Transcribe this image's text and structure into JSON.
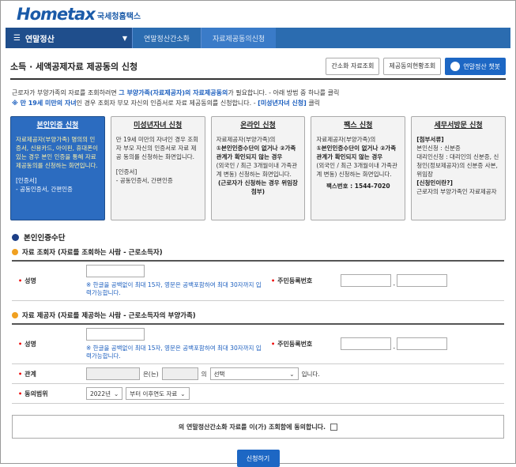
{
  "header": {
    "logo": "Hometax",
    "logo_sub": "국세청홈택스"
  },
  "nav": {
    "main": "연말정산",
    "crumbs": [
      "연말정산간소화",
      "자료제공동의신청"
    ]
  },
  "title": "소득 · 세액공제자료 제공동의 신청",
  "title_buttons": [
    "간소화 자료조회",
    "제공동의현황조회",
    "연말정산 챗봇"
  ],
  "intro": {
    "line1_a": "근로자가 부양가족의 자료를 조회하려면 ",
    "line1_hl": "그 부양가족(자료제공자)의 자료제공동의",
    "line1_b": "가 필요합니다. - 아래 방법 중 하나를 클릭",
    "line2_hl": "※ 만 19세 미만의 자녀",
    "line2_a": "인 경우 조회자 부모 자신의 인증서로 자료 제공동의를 신청합니다. - ",
    "line2_hl2": "[미성년자녀 신청]",
    "line2_b": " 클릭"
  },
  "cards": [
    {
      "title": "본인인증 신청",
      "body1": "자료제공자(부양가족) 명의의 인증서, 신용카드, 아이핀, 휴대폰이 있는 경우 본인 인증을 통해 자료제공동의를 신청하는 화면입니다.",
      "body2": "[인증서]",
      "body3": "- 공동인증서, 간편인증"
    },
    {
      "title": "미성년자녀 신청",
      "body1": "만 19세 미만의 자녀인 경우 조회자 부모 자신의 인증서로 자료 제공 동의를 신청하는 화면입니다.",
      "body2": "[인증서]",
      "body3": "- 공동인증서, 간편인증"
    },
    {
      "title": "온라인 신청",
      "body1": "자료제공자(부양가족)의",
      "body2": "①본인인증수단이 없거나 ②가족관계가 확인되지 않는 경우",
      "body3": "(외국인 / 최근 3개월이내 가족관계 변동) 신청하는 화면입니다.",
      "body4": "(근로자가 신청하는 경우 위임장 첨부)"
    },
    {
      "title": "팩스 신청",
      "body1": "자료제공자(부양가족)의",
      "body2": "①본인인증수단이 없거나 ②가족관계가 확인되지 않는 경우",
      "body3": "(외국인 / 최근 3개월이내 가족관계 변동) 신청하는 화면입니다.",
      "body4": "팩스번호 : 1544-7020"
    },
    {
      "title": "세무서방문 신청",
      "body1": "[첨부서류]",
      "body2": "본인신청 : 신분증",
      "body3": "대리인신청 : 대리인의 신분증, 신청인(정보제공자)의 신분증 사본, 위임장",
      "body4": "[신청인이란?]",
      "body5": "근로자의 부양가족인 자료제공자"
    }
  ],
  "section_title": "본인인증수단",
  "viewer": {
    "heading": "자료 조회자 (자료를 조회하는 사람 - 근로소득자)",
    "name_label": "성명",
    "name_note": "※ 한글을 공백없이 최대 15자, 영문은 공백포함하여 최대 30자까지 입력가능합니다.",
    "rrn_label": "주민등록번호"
  },
  "provider": {
    "heading": "자료 제공자 (자료를 제공하는 사람 - 근로소득자의 부양가족)",
    "name_label": "성명",
    "name_note": "※ 한글을 공백없이 최대 15자, 영문은 공백포함하여 최대 30자까지 입력가능합니다.",
    "rrn_label": "주민등록번호",
    "relation_label": "관계",
    "relation_mid": "은(는)",
    "relation_of": "의",
    "relation_select": "선택",
    "relation_end": "입니다.",
    "range_label": "동의범위",
    "range_year": "2022년",
    "range_scope": "부터 이후연도 자료"
  },
  "consent": "의 연말정산간소화 자료를 이(가) 조회함에 동의합니다.",
  "submit": "신청하기",
  "colors": {
    "brand": "#1d67c4",
    "nav": "#2b6cb0",
    "active_card": "#2c6cc0"
  }
}
